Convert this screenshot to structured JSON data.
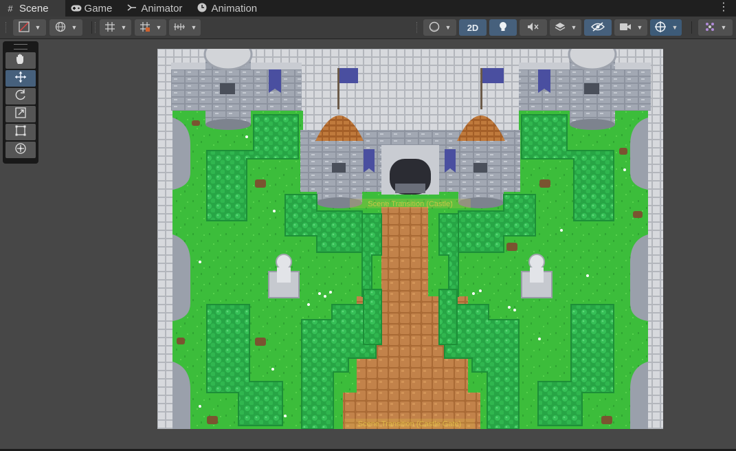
{
  "tabs": [
    {
      "label": "Scene",
      "icon": "grid-icon",
      "active": true
    },
    {
      "label": "Game",
      "icon": "gamepad-icon",
      "active": false
    },
    {
      "label": "Animator",
      "icon": "animator-icon",
      "active": false
    },
    {
      "label": "Animation",
      "icon": "clock-icon",
      "active": false
    }
  ],
  "toolbar": {
    "mode_2d_label": "2D"
  },
  "tools": [
    "hand-tool",
    "move-tool",
    "rotate-tool",
    "scale-tool",
    "rect-tool",
    "transform-tool"
  ],
  "scene": {
    "transition_label_castle": "Scene Transition (Castle)",
    "transition_label_gate": "Scene Transition (Castle Gate)"
  },
  "colors": {
    "accent": "#46607c",
    "grass": "#3fbf3a",
    "hedge": "#2fb54a",
    "stone": "#b7b9bf",
    "path": "#b87a3e",
    "roof": "#b06a2c",
    "banner": "#4a4fa0"
  }
}
